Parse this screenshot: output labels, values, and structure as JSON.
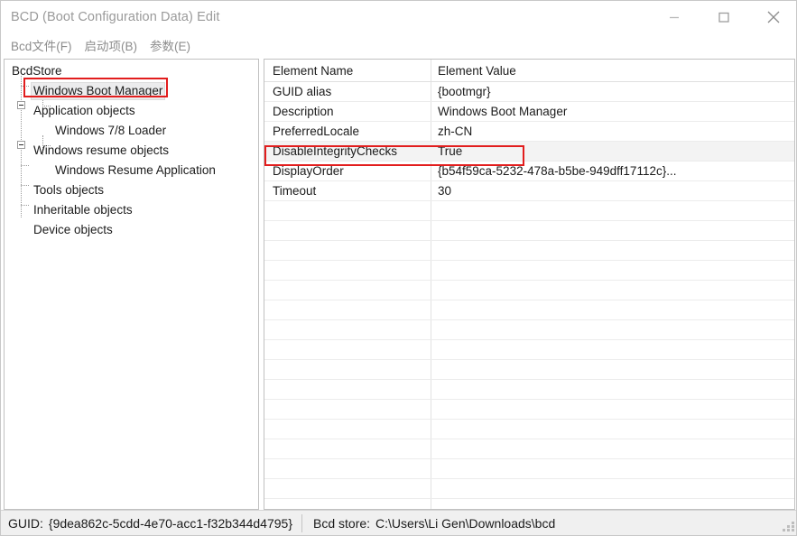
{
  "window": {
    "title": "BCD (Boot Configuration Data) Edit",
    "controls": {
      "minimize": "minimize-icon",
      "maximize": "maximize-icon",
      "close": "close-icon"
    }
  },
  "menubar": {
    "items": [
      {
        "label": "Bcd文件(F)"
      },
      {
        "label": "启动项(B)"
      },
      {
        "label": "参数(E)"
      }
    ]
  },
  "tree": {
    "nodes": [
      {
        "label": "BcdStore",
        "level": 0,
        "expander": false,
        "selected": false
      },
      {
        "label": "Windows Boot Manager",
        "level": 1,
        "expander": false,
        "selected": true
      },
      {
        "label": "Application objects",
        "level": 1,
        "expander": true,
        "selected": false
      },
      {
        "label": "Windows 7/8 Loader",
        "level": 2,
        "expander": false,
        "selected": false
      },
      {
        "label": "Windows resume objects",
        "level": 1,
        "expander": true,
        "selected": false
      },
      {
        "label": "Windows Resume Application",
        "level": 2,
        "expander": false,
        "selected": false
      },
      {
        "label": "Tools objects",
        "level": 1,
        "expander": false,
        "selected": false
      },
      {
        "label": "Inheritable objects",
        "level": 1,
        "expander": false,
        "selected": false
      },
      {
        "label": "Device objects",
        "level": 1,
        "expander": false,
        "selected": false
      }
    ]
  },
  "table": {
    "columns": {
      "name": "Element Name",
      "value": "Element Value"
    },
    "rows": [
      {
        "name": "GUID alias",
        "value": "{bootmgr}",
        "selected": false
      },
      {
        "name": "Description",
        "value": "Windows Boot Manager",
        "selected": false
      },
      {
        "name": "PreferredLocale",
        "value": "zh-CN",
        "selected": false
      },
      {
        "name": "DisableIntegrityChecks",
        "value": "True",
        "selected": true
      },
      {
        "name": "DisplayOrder",
        "value": "{b54f59ca-5232-478a-b5be-949dff17112c}...",
        "selected": false
      },
      {
        "name": "Timeout",
        "value": "30",
        "selected": false
      }
    ],
    "empty_row_count": 16
  },
  "statusbar": {
    "guid_label": "GUID:",
    "guid_value": "{9dea862c-5cdd-4e70-acc1-f32b344d4795}",
    "store_label": "Bcd store:",
    "store_value": "C:\\Users\\Li Gen\\Downloads\\bcd"
  },
  "annotations": {
    "accent_color": "#e21d1d",
    "highlights": [
      {
        "target": "tree-node-windows-boot-manager"
      },
      {
        "target": "table-row-disableintegritychecks"
      }
    ]
  }
}
